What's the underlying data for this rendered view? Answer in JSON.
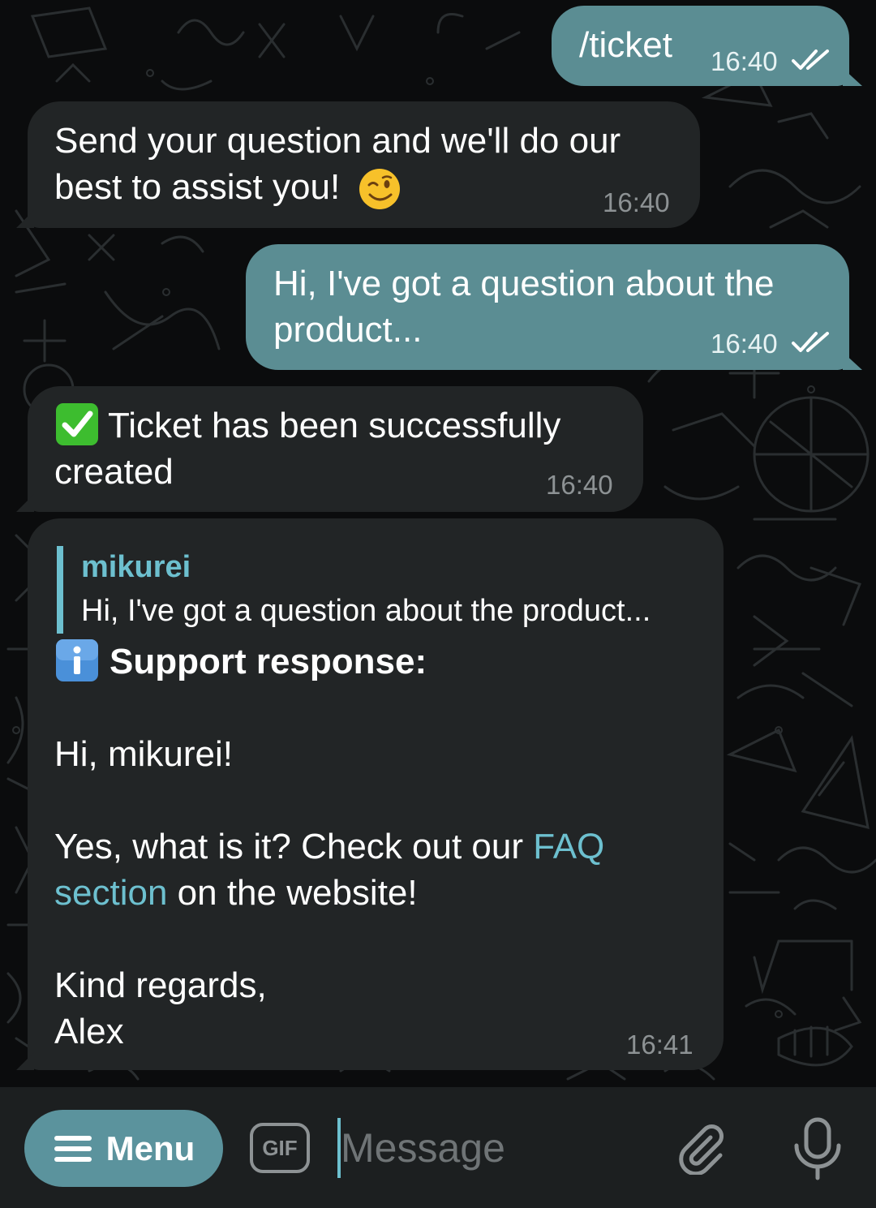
{
  "chat": {
    "messages": [
      {
        "direction": "outgoing",
        "text": "/ticket",
        "time": "16:40",
        "status": "read"
      },
      {
        "direction": "incoming",
        "line1": "Send your question and we'll do our",
        "line2": "best to assist you!",
        "emoji": "winking-face",
        "time": "16:40"
      },
      {
        "direction": "outgoing",
        "line1": "Hi, I've got a question about the",
        "line2": "product...",
        "time": "16:40",
        "status": "read"
      },
      {
        "direction": "incoming",
        "emoji": "check-mark-button",
        "line1": "Ticket has been successfully",
        "line2": "created",
        "time": "16:40"
      },
      {
        "direction": "incoming",
        "quote": {
          "author": "mikurei",
          "text": "Hi, I've got a question about the product..."
        },
        "emoji": "information-icon",
        "heading": "Support response:",
        "greeting": "Hi, mikurei!",
        "body_before_link": "Yes, what is it? Check out our ",
        "link_part1": "FAQ",
        "link_part2": "section",
        "body_after_link": " on the website!",
        "closing": "Kind regards,",
        "signature": "Alex",
        "time": "16:41"
      }
    ]
  },
  "input_bar": {
    "menu_label": "Menu",
    "gif_label": "GIF",
    "placeholder": "Message"
  },
  "colors": {
    "background": "#0b0c0d",
    "incoming_bubble": "#222526",
    "outgoing_bubble": "#5b8d93",
    "accent": "#6dc0cf",
    "timestamp_incoming": "#8d9294",
    "menu_button": "#5b939d",
    "input_bar": "#1c1f20"
  }
}
